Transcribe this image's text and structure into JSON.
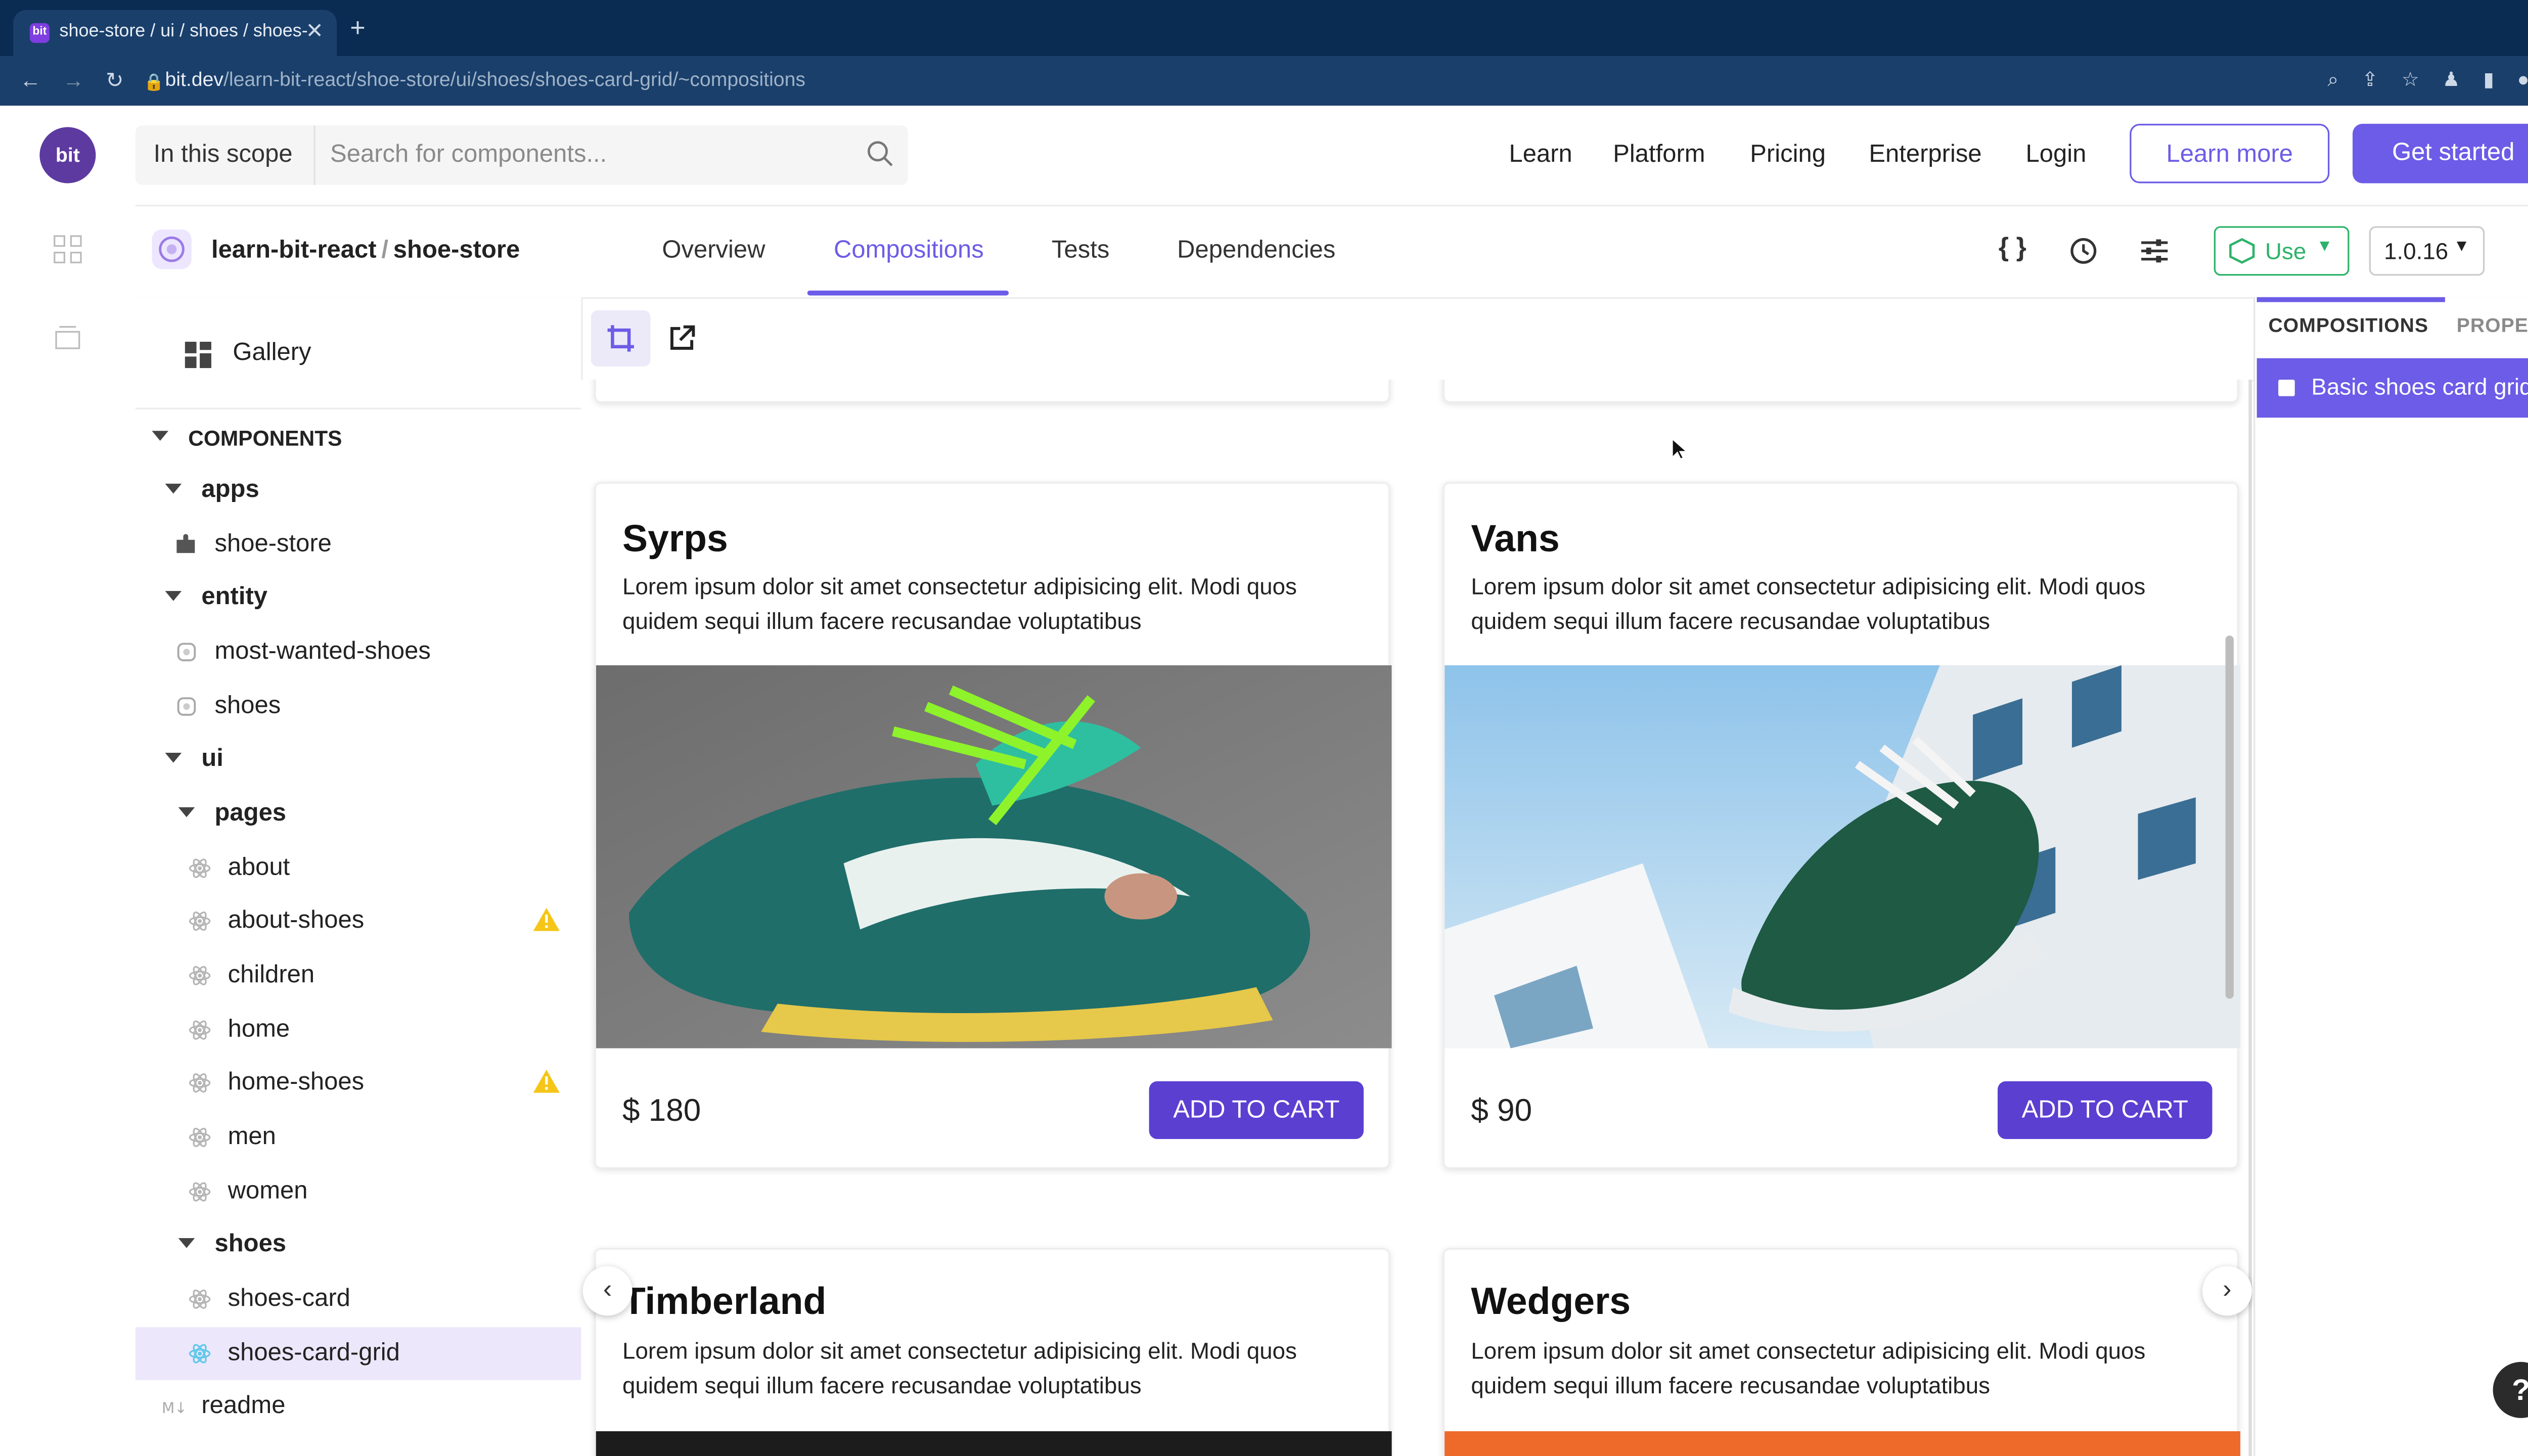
{
  "browser": {
    "tab_title": "shoe-store / ui / shoes / shoes-card-grid",
    "tab_favicon": "bit",
    "url_host": "bit.dev",
    "url_path": "/learn-bit-react/shoe-store/ui/shoes/shoes-card-grid/~compositions"
  },
  "header": {
    "logo": "bit",
    "scope_label": "In this scope",
    "search_placeholder": "Search for components...",
    "nav": [
      "Learn",
      "Platform",
      "Pricing",
      "Enterprise",
      "Login"
    ],
    "learn_more": "Learn more",
    "get_started": "Get started"
  },
  "component": {
    "owner": "learn-bit-react",
    "separator": "/",
    "scope": "shoe-store",
    "tabs": [
      "Overview",
      "Compositions",
      "Tests",
      "Dependencies"
    ],
    "active_tab": "Compositions",
    "use_label": "Use",
    "version": "1.0.16"
  },
  "sidebar": {
    "gallery": "Gallery",
    "section": "COMPONENTS",
    "tree": [
      {
        "label": "apps",
        "kind": "folder"
      },
      {
        "label": "shoe-store",
        "kind": "app"
      },
      {
        "label": "entity",
        "kind": "folder"
      },
      {
        "label": "most-wanted-shoes",
        "kind": "entity"
      },
      {
        "label": "shoes",
        "kind": "entity"
      },
      {
        "label": "ui",
        "kind": "folder"
      },
      {
        "label": "pages",
        "kind": "folder"
      },
      {
        "label": "about",
        "kind": "react"
      },
      {
        "label": "about-shoes",
        "kind": "react",
        "warning": true
      },
      {
        "label": "children",
        "kind": "react"
      },
      {
        "label": "home",
        "kind": "react"
      },
      {
        "label": "home-shoes",
        "kind": "react",
        "warning": true
      },
      {
        "label": "men",
        "kind": "react"
      },
      {
        "label": "women",
        "kind": "react"
      },
      {
        "label": "shoes",
        "kind": "folder"
      },
      {
        "label": "shoes-card",
        "kind": "react"
      },
      {
        "label": "shoes-card-grid",
        "kind": "react",
        "selected": true
      },
      {
        "label": "readme",
        "kind": "markdown"
      }
    ]
  },
  "preview": {
    "cards": [
      {
        "title": "Syrps",
        "description": "Lorem ipsum dolor sit amet consectetur adipisicing elit. Modi quos quidem sequi illum facere recusandae voluptatibus",
        "price": "$ 180",
        "cta": "ADD TO CART"
      },
      {
        "title": "Vans",
        "description": "Lorem ipsum dolor sit amet consectetur adipisicing elit. Modi quos quidem sequi illum facere recusandae voluptatibus",
        "price": "$ 90",
        "cta": "ADD TO CART"
      },
      {
        "title": "Timberland",
        "description": "Lorem ipsum dolor sit amet consectetur adipisicing elit. Modi quos quidem sequi illum facere recusandae voluptatibus"
      },
      {
        "title": "Wedgers",
        "description": "Lorem ipsum dolor sit amet consectetur adipisicing elit. Modi quos quidem sequi illum facere recusandae voluptatibus"
      }
    ]
  },
  "right_panel": {
    "tabs": [
      "COMPOSITIONS",
      "PROPERTIES"
    ],
    "composition": "Basic shoes card grid"
  },
  "help": "?",
  "colors": {
    "accent": "#6c5ce7",
    "use_green": "#2db369",
    "chrome_dark": "#0b2c52",
    "cart_button": "#5b3fd1",
    "warning": "#f5c518"
  }
}
